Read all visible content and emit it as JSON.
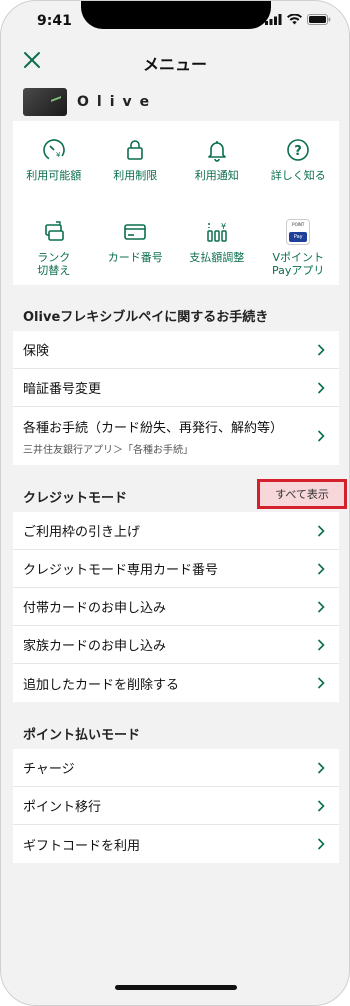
{
  "status": {
    "time": "9:41"
  },
  "header": {
    "title": "メニュー"
  },
  "card": {
    "brand": "Olive"
  },
  "icons": [
    {
      "label": "利用可能額",
      "icon": "gauge-yen-icon"
    },
    {
      "label": "利用制限",
      "icon": "lock-icon"
    },
    {
      "label": "利用通知",
      "icon": "bell-icon"
    },
    {
      "label": "詳しく知る",
      "icon": "question-icon"
    },
    {
      "label": "ランク\n切替え",
      "icon": "rank-switch-icon"
    },
    {
      "label": "カード番号",
      "icon": "card-icon"
    },
    {
      "label": "支払額調整",
      "icon": "adjust-yen-icon"
    },
    {
      "label": "Vポイント\nPayアプリ",
      "icon": "vpoint-pay-icon"
    }
  ],
  "flexible": {
    "title": "Oliveフレキシブルペイに関するお手続き",
    "items": [
      {
        "label": "保険"
      },
      {
        "label": "暗証番号変更"
      },
      {
        "label": "各種お手続（カード紛失、再発行、解約等）",
        "sub": "三井住友銀行アプリ＞「各種お手続」"
      }
    ]
  },
  "credit": {
    "title": "クレジットモード",
    "show_all": "すべて表示",
    "items": [
      {
        "label": "ご利用枠の引き上げ"
      },
      {
        "label": "クレジットモード専用カード番号"
      },
      {
        "label": "付帯カードのお申し込み"
      },
      {
        "label": "家族カードのお申し込み"
      },
      {
        "label": "追加したカードを削除する"
      }
    ]
  },
  "points": {
    "title": "ポイント払いモード",
    "items": [
      {
        "label": "チャージ"
      },
      {
        "label": "ポイント移行"
      },
      {
        "label": "ギフトコードを利用"
      }
    ]
  },
  "vpay_badge": {
    "top": "POINT",
    "bottom": "Pay"
  },
  "colors": {
    "accent": "#0b6e4f",
    "highlight_border": "#d41f2d",
    "background": "#f2f2f2"
  }
}
